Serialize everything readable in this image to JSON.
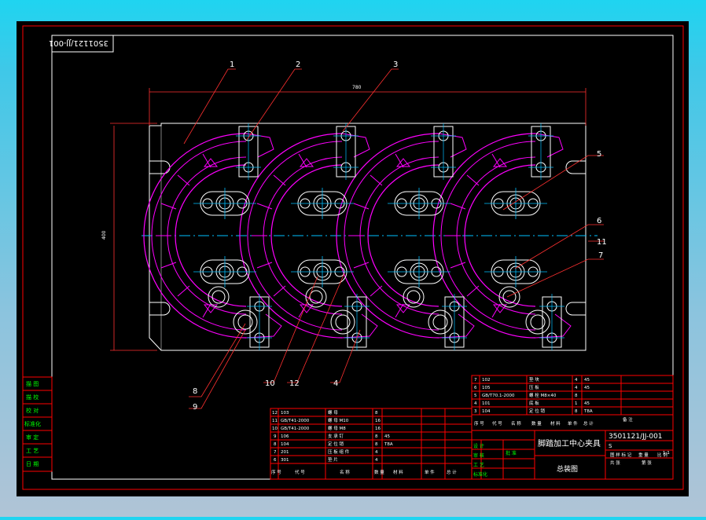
{
  "drawing_number": "3501121/JJ-001",
  "top_stamp": "3501121/JJ-001",
  "title_cn": "脚踏加工中心夹具",
  "subtitle_cn": "总装图",
  "callouts": [
    "1",
    "2",
    "3",
    "4",
    "5",
    "6",
    "7",
    "8",
    "9",
    "10",
    "11",
    "12"
  ],
  "dimensions": {
    "width_label": "780",
    "height_label": "400"
  },
  "left_block_rows": [
    "描 图",
    "描 校",
    "校 对",
    "标准化",
    "审 定",
    "工 艺",
    "日 期"
  ],
  "parts_upper": [
    {
      "no": "7",
      "code": "102",
      "name": "垫 块",
      "qty": "4",
      "mat": "45"
    },
    {
      "no": "6",
      "code": "105",
      "name": "压 板",
      "qty": "4",
      "mat": "45"
    },
    {
      "no": "5",
      "code": "GB/T70.1-2000",
      "name": "螺 栓 M8×40",
      "qty": "8",
      "mat": ""
    },
    {
      "no": "4",
      "code": "101",
      "name": "底 板",
      "qty": "1",
      "mat": "45"
    },
    {
      "no": "3",
      "code": "104",
      "name": "定 位 销",
      "qty": "8",
      "mat": "T8A"
    }
  ],
  "parts_lower": [
    {
      "no": "12",
      "code": "103",
      "name": "螺 母",
      "qty": "8",
      "mat": ""
    },
    {
      "no": "11",
      "code": "GB/T41-2000",
      "name": "螺 母 M10",
      "qty": "16",
      "mat": ""
    },
    {
      "no": "10",
      "code": "GB/T41-2000",
      "name": "螺 母 M8",
      "qty": "16",
      "mat": ""
    },
    {
      "no": "9",
      "code": "106",
      "name": "支 承 钉",
      "qty": "8",
      "mat": "45"
    },
    {
      "no": "8",
      "code": "104",
      "name": "定 位 销",
      "qty": "8",
      "mat": "T8A"
    },
    {
      "no": "7",
      "code": "201",
      "name": "压 板 组 件",
      "qty": "4",
      "mat": ""
    },
    {
      "no": "6",
      "code": "301",
      "name": "垫 片",
      "qty": "4",
      "mat": ""
    }
  ],
  "header_labels": [
    "序 号",
    "代 号",
    "名 称",
    "数 量",
    "材 料",
    "单 件",
    "总 计",
    "备 注"
  ],
  "sign_labels": [
    "设 计",
    "审 核",
    "工 艺",
    "标准化",
    "批 准"
  ],
  "scale_labels": [
    "图 样 标 记",
    "重 量",
    "比 例"
  ],
  "scale_value": "1:1",
  "sheet_labels": [
    "共  张",
    "第  张"
  ],
  "colors": {
    "border": "#ff0000",
    "frame": "#ffffff",
    "part": "#ff00ff",
    "center": "#00bfff",
    "table_text": "#00ff00",
    "dim": "#ff3030"
  }
}
